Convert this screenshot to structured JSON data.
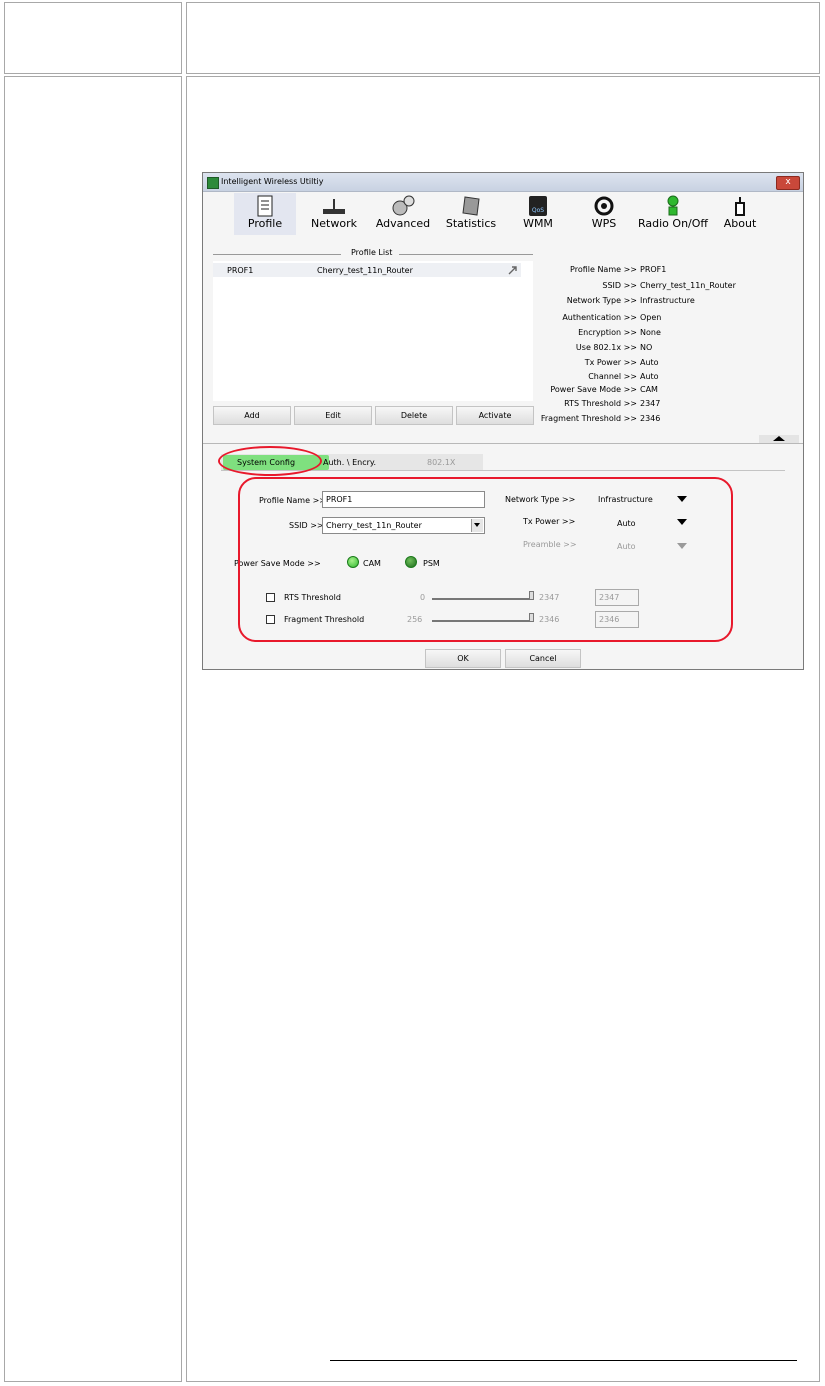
{
  "window": {
    "title": "Intelligent Wireless Utiltiy",
    "close_label": "x"
  },
  "toolbar": [
    {
      "label": "Profile",
      "icon": "profile-icon"
    },
    {
      "label": "Network",
      "icon": "network-icon"
    },
    {
      "label": "Advanced",
      "icon": "advanced-icon"
    },
    {
      "label": "Statistics",
      "icon": "statistics-icon"
    },
    {
      "label": "WMM",
      "icon": "wmm-icon"
    },
    {
      "label": "WPS",
      "icon": "wps-icon"
    },
    {
      "label": "Radio On/Off",
      "icon": "radio-icon"
    },
    {
      "label": "About",
      "icon": "about-icon"
    }
  ],
  "profile_list": {
    "header": "Profile List",
    "rows": [
      {
        "name": "PROF1",
        "ssid": "Cherry_test_11n_Router"
      }
    ],
    "buttons": {
      "add": "Add",
      "edit": "Edit",
      "delete": "Delete",
      "activate": "Activate"
    }
  },
  "details": [
    {
      "k": "Profile Name >>",
      "v": "PROF1"
    },
    {
      "k": "SSID >>",
      "v": "Cherry_test_11n_Router"
    },
    {
      "k": "Network Type >>",
      "v": "Infrastructure"
    },
    {
      "k": "Authentication >>",
      "v": "Open"
    },
    {
      "k": "Encryption >>",
      "v": "None"
    },
    {
      "k": "Use 802.1x >>",
      "v": "NO"
    },
    {
      "k": "Tx Power >>",
      "v": "Auto"
    },
    {
      "k": "Channel >>",
      "v": "Auto"
    },
    {
      "k": "Power Save Mode >>",
      "v": "CAM"
    },
    {
      "k": "RTS Threshold >>",
      "v": "2347"
    },
    {
      "k": "Fragment Threshold >>",
      "v": "2346"
    }
  ],
  "tabs": {
    "system_config": "System Config",
    "auth": "Auth. \\ Encry.",
    "dot1x": "802.1X"
  },
  "config": {
    "profile_name_label": "Profile Name >>",
    "profile_name_value": "PROF1",
    "ssid_label": "SSID >>",
    "ssid_value": "Cherry_test_11n_Router",
    "network_type_label": "Network Type >>",
    "network_type_value": "Infrastructure",
    "tx_power_label": "Tx Power >>",
    "tx_power_value": "Auto",
    "preamble_label": "Preamble >>",
    "preamble_value": "Auto",
    "power_save_label": "Power Save Mode >>",
    "cam_label": "CAM",
    "psm_label": "PSM",
    "rts_label": "RTS Threshold",
    "rts_min": "0",
    "rts_max": "2347",
    "rts_value": "2347",
    "frag_label": "Fragment Threshold",
    "frag_min": "256",
    "frag_max": "2346",
    "frag_value": "2346"
  },
  "dialog_buttons": {
    "ok": "OK",
    "cancel": "Cancel"
  },
  "colors": {
    "highlight": "#e8192c",
    "tab_active": "#7fe07f"
  }
}
